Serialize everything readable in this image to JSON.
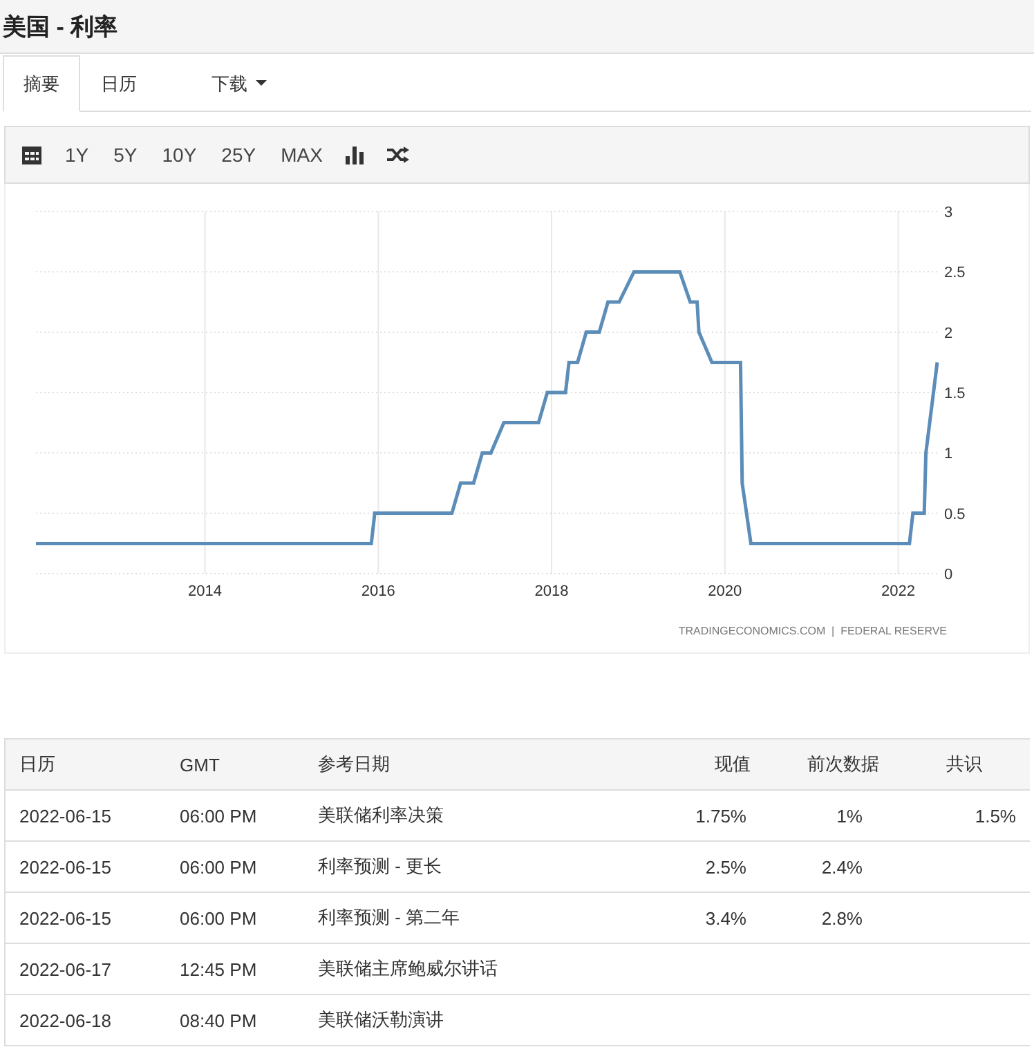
{
  "page_title": "美国 - 利率",
  "tabs": [
    {
      "label": "摘要",
      "selected": true,
      "dropdown": false
    },
    {
      "label": "日历",
      "selected": false,
      "dropdown": false
    },
    {
      "label": "下载",
      "selected": false,
      "dropdown": true
    }
  ],
  "toolbar": [
    {
      "kind": "calendar"
    },
    {
      "kind": "range",
      "label": "1Y"
    },
    {
      "kind": "range",
      "label": "5Y"
    },
    {
      "kind": "range",
      "label": "10Y"
    },
    {
      "kind": "range",
      "label": "25Y"
    },
    {
      "kind": "range",
      "label": "MAX"
    },
    {
      "kind": "bars"
    },
    {
      "kind": "shuffle"
    }
  ],
  "chart": {
    "source": "TRADINGECONOMICS.COM  |  FEDERAL RESERVE",
    "chart_data": {
      "type": "line",
      "grid": true,
      "xlim": [
        2012.05,
        2022.45
      ],
      "ylim": [
        0,
        3
      ],
      "xticks": [
        2014,
        2016,
        2018,
        2020,
        2022
      ],
      "yticks": [
        0,
        0.5,
        1,
        1.5,
        2,
        2.5,
        3
      ],
      "x": [
        2012.05,
        2015.92,
        2015.96,
        2016.85,
        2016.95,
        2017.1,
        2017.2,
        2017.3,
        2017.45,
        2017.85,
        2017.95,
        2018.16,
        2018.2,
        2018.3,
        2018.4,
        2018.55,
        2018.65,
        2018.78,
        2018.95,
        2019.48,
        2019.6,
        2019.68,
        2019.7,
        2019.85,
        2020.18,
        2020.2,
        2020.3,
        2022.13,
        2022.17,
        2022.3,
        2022.32,
        2022.45
      ],
      "series": [
        {
          "color": "#5b8db8",
          "values": [
            0.25,
            0.25,
            0.5,
            0.5,
            0.75,
            0.75,
            1,
            1,
            1.25,
            1.25,
            1.5,
            1.5,
            1.75,
            1.75,
            2,
            2,
            2.25,
            2.25,
            2.5,
            2.5,
            2.25,
            2.25,
            2,
            1.75,
            1.75,
            0.75,
            0.25,
            0.25,
            0.5,
            0.5,
            1,
            1.75
          ]
        }
      ]
    }
  },
  "table": {
    "columns": [
      "日历",
      "GMT",
      "参考日期",
      "现值",
      "前次数据",
      "共识"
    ],
    "rows": [
      [
        "2022-06-15",
        "06:00 PM",
        "美联储利率决策",
        "1.75%",
        "1%",
        "1.5%"
      ],
      [
        "2022-06-15",
        "06:00 PM",
        "利率预测 - 更长",
        "2.5%",
        "2.4%",
        ""
      ],
      [
        "2022-06-15",
        "06:00 PM",
        "利率预测 - 第二年",
        "3.4%",
        "2.8%",
        ""
      ],
      [
        "2022-06-17",
        "12:45 PM",
        "美联储主席鲍威尔讲话",
        "",
        "",
        ""
      ],
      [
        "2022-06-18",
        "08:40 PM",
        "美联储沃勒演讲",
        "",
        "",
        ""
      ]
    ]
  }
}
